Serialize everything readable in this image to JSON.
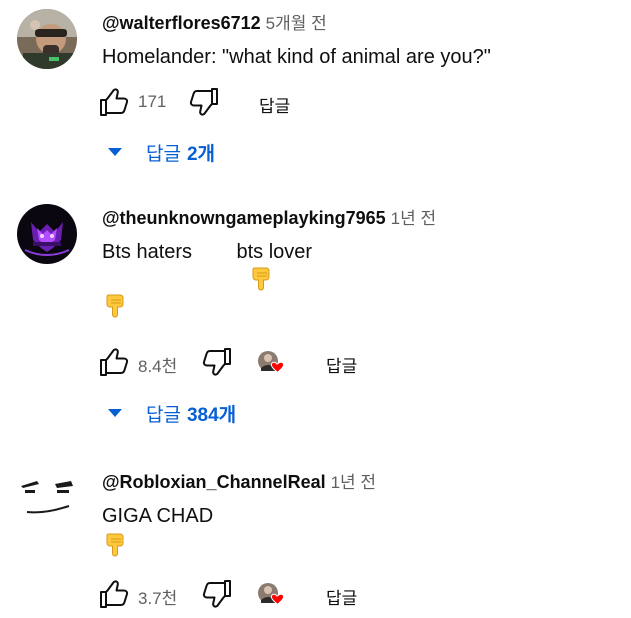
{
  "comments": [
    {
      "author": "@walterflores6712",
      "time": "5개월 전",
      "lines": [
        "Homelander: \"what kind of animal are you?\""
      ],
      "likes": "171",
      "reply_label": "답글",
      "replies": {
        "label": "답글",
        "count": "2개"
      },
      "creator_heart": false
    },
    {
      "author": "@theunknowngameplayking7965",
      "time": "1년 전",
      "lines": [
        "Bts haters        bts lover"
      ],
      "likes": "8.4천",
      "reply_label": "답글",
      "replies": {
        "label": "답글",
        "count": "384개"
      },
      "creator_heart": true
    },
    {
      "author": "@Robloxian_ChannelReal",
      "time": "1년 전",
      "lines": [
        "GIGA CHAD"
      ],
      "likes": "3.7천",
      "reply_label": "답글",
      "creator_heart": true
    }
  ],
  "icons": {
    "like": "thumb-up-outline-icon",
    "dislike": "thumb-down-outline-icon",
    "emoji": "backhand-index-pointing-down-emoji",
    "caret": "caret-down-icon",
    "heart": "creator-heart-icon"
  },
  "colors": {
    "link_blue": "#065fd4",
    "secondary_text": "#606060",
    "primary_text": "#0f0f0f",
    "heart_red": "#ff0000",
    "emoji_yellow": "#ffc83d"
  }
}
